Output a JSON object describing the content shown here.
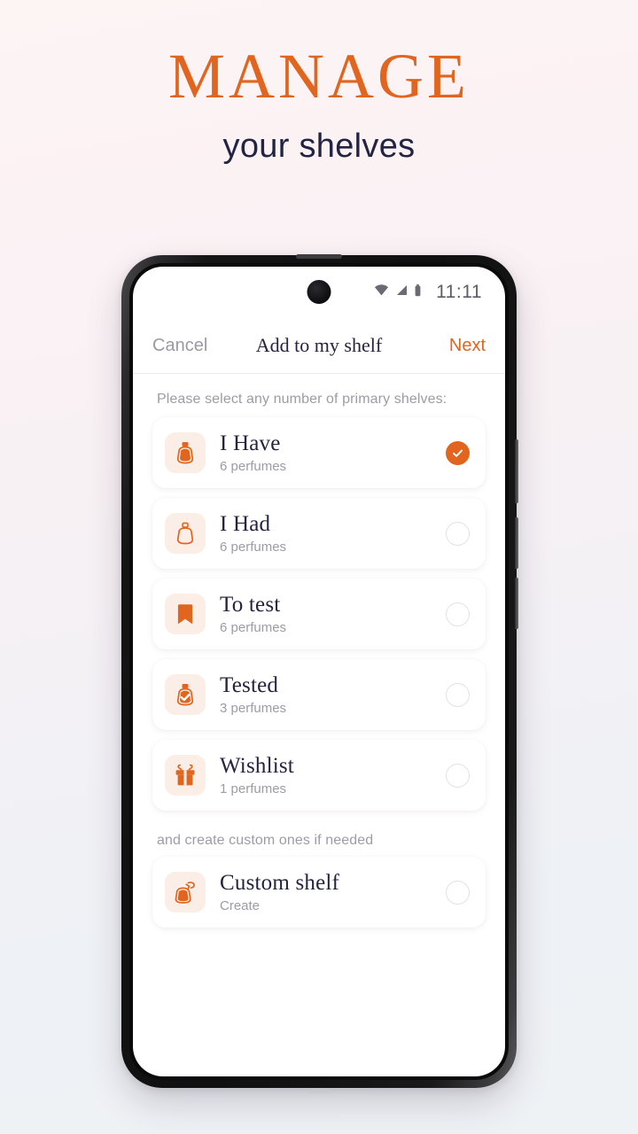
{
  "promo": {
    "title": "MANAGE",
    "subtitle": "your shelves",
    "title_color": "#e2651f",
    "subtitle_color": "#232443"
  },
  "status_bar": {
    "time": "11:11",
    "icons": [
      "wifi-icon",
      "cellular-signal-icon",
      "battery-icon"
    ]
  },
  "nav": {
    "cancel_label": "Cancel",
    "title": "Add to my shelf",
    "next_label": "Next",
    "next_color": "#e2651f"
  },
  "content": {
    "primary_label": "Please select any number of primary shelves:",
    "custom_label": "and create custom ones if needed",
    "accent_color": "#e2651f",
    "tile_bg": "#fbeee6",
    "primary_shelves": [
      {
        "title": "I Have",
        "subtitle": "6 perfumes",
        "icon": "perfume-bottle-filled-icon",
        "selected": true
      },
      {
        "title": "I Had",
        "subtitle": "6 perfumes",
        "icon": "perfume-bottle-outline-icon",
        "selected": false
      },
      {
        "title": "To test",
        "subtitle": "6 perfumes",
        "icon": "bookmark-icon",
        "selected": false
      },
      {
        "title": "Tested",
        "subtitle": "3 perfumes",
        "icon": "perfume-bottle-check-icon",
        "selected": false
      },
      {
        "title": "Wishlist",
        "subtitle": "1 perfumes",
        "icon": "gift-icon",
        "selected": false
      }
    ],
    "custom_shelves": [
      {
        "title": "Custom shelf",
        "subtitle": "Create",
        "icon": "perfume-atomizer-icon",
        "selected": false
      }
    ]
  }
}
